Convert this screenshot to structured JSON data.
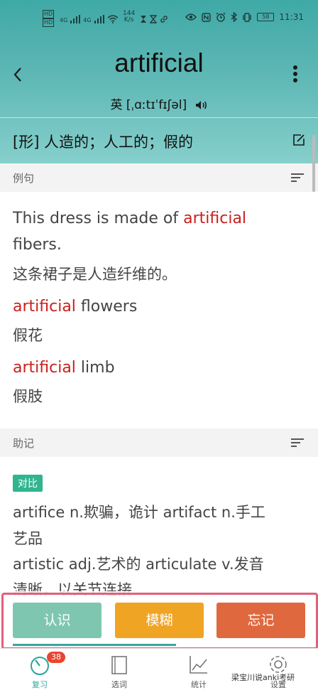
{
  "status_bar": {
    "hd1": "HD",
    "hd2": "HD",
    "net1": "4G",
    "net2": "4G",
    "speed": "144 K/s",
    "battery": "58",
    "time": "11:31"
  },
  "header": {
    "word": "artificial",
    "phonetic_prefix": "英",
    "phonetic": "[ˌɑːtɪˈfɪʃəl]",
    "definition": "[形] 人造的；人工的；假的"
  },
  "examples": {
    "title": "例句",
    "items": [
      {
        "before": "This dress is made of ",
        "term": "artificial",
        "after": "",
        "line2": "fibers.",
        "cn": "这条裙子是人造纤维的。"
      },
      {
        "term": "artificial",
        "after": " flowers",
        "cn": "假花"
      },
      {
        "term": "artificial",
        "after": " limb",
        "cn": "假肢"
      }
    ]
  },
  "mnemonic": {
    "title": "助记",
    "tag": "对比",
    "lines": [
      "artifice n.欺骗，诡计  artifact n.手工",
      "艺品",
      "artistic adj.艺术的  articulate v.发音",
      "清晰，以关节连接"
    ]
  },
  "actions": {
    "know": "认识",
    "fuzzy": "模糊",
    "forget": "忘记"
  },
  "tabs": [
    {
      "label": "复习",
      "badge": "38"
    },
    {
      "label": "选词"
    },
    {
      "label": "统计"
    },
    {
      "label": "设置"
    }
  ],
  "watermark": "梁宝川说anki考研",
  "colors": {
    "header_top": "#3fa9a6",
    "highlight": "#c8201e",
    "know": "#7fc6b0",
    "fuzzy": "#f0a424",
    "forget": "#e0683f",
    "tag": "#31b58f",
    "badge": "#e9452f"
  }
}
